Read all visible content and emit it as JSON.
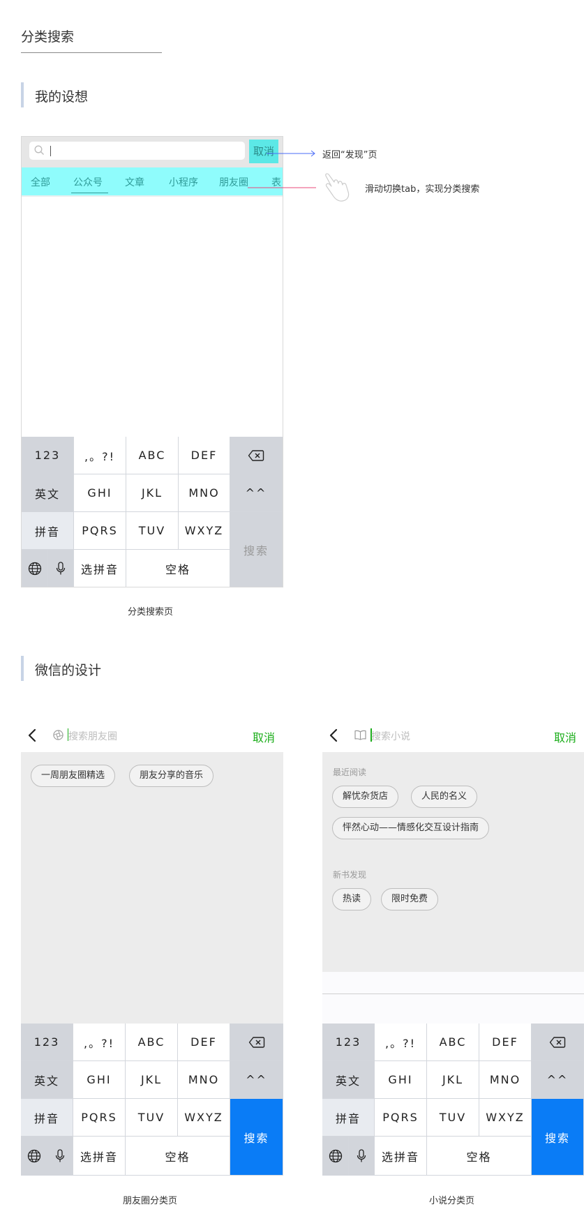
{
  "page": {
    "title": "分类搜索",
    "section1": "我的设想",
    "section2": "微信的设计"
  },
  "mockup1": {
    "search_caret": "|",
    "cancel": "取消",
    "tabs": [
      "全部",
      "公众号",
      "文章",
      "小程序",
      "朋友圈",
      "表"
    ],
    "caption": "分类搜索页",
    "annotation_cancel": "返回“发现”页",
    "annotation_swipe": "滑动切换tab，实现分类搜索"
  },
  "keyboard": {
    "num": "123",
    "punct": ",。?!",
    "abc": "ABC",
    "def": "DEF",
    "eng": "英文",
    "ghi": "GHI",
    "jkl": "JKL",
    "mno": "MNO",
    "emoji": "^^",
    "pinyin": "拼音",
    "pqrs": "PQRS",
    "tuv": "TUV",
    "wxyz": "WXYZ",
    "search": "搜索",
    "select_pinyin": "选拼音",
    "space": "空格"
  },
  "mockup2": {
    "placeholder": "搜索朋友圈",
    "cancel": "取消",
    "chips": [
      "一周朋友圈精选",
      "朋友分享的音乐"
    ],
    "caption": "朋友圈分类页"
  },
  "mockup3": {
    "placeholder": "搜索小说",
    "cancel": "取消",
    "recent_label": "最近阅读",
    "recent_chips": [
      "解忧杂货店",
      "人民的名义",
      "怦然心动——情感化交互设计指南"
    ],
    "discover_label": "新书发现",
    "discover_chips": [
      "热读",
      "限时免费"
    ],
    "caption": "小说分类页"
  },
  "colors": {
    "wechat_green": "#1aad19",
    "search_blue": "#0a7cf6",
    "highlight_cyan": "#8ffcfc"
  },
  "icons": [
    "search-icon",
    "back-chevron-icon",
    "moments-icon",
    "book-icon",
    "backspace-icon",
    "globe-icon",
    "mic-icon",
    "hand-swipe-icon"
  ]
}
